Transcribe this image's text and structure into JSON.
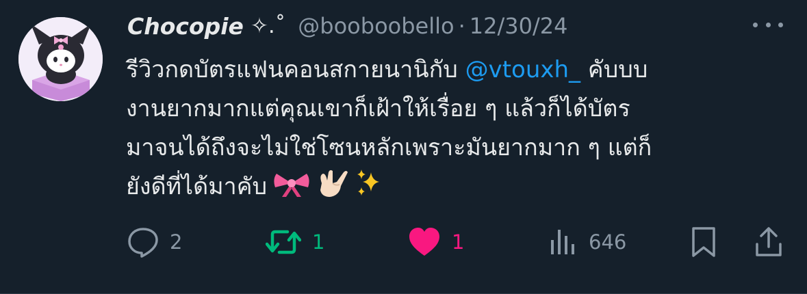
{
  "tweet": {
    "display_name": "Chocopie",
    "name_decoration": "✧.˚",
    "handle": "@booboobello",
    "separator": "·",
    "date": "12/30/24",
    "text_lines": [
      {
        "before": "รีวิวกดบัตรแฟนคอนสกายนานิกับ ",
        "mention": "@vtouxh_",
        "after": " คับบบ"
      },
      {
        "text": "งานยากมากแต่คุณเขาก็เฝ้าให้เรื่อย ๆ แล้วก็ได้บัตร"
      },
      {
        "text": "มาจนได้ถึงจะไม่ใช่โซนหลักเพราะมันยากมาก ๆ แต่ก็"
      },
      {
        "text": "ยังดีที่ได้มาคับ"
      }
    ],
    "emojis": [
      "ribbon-emoji",
      "rock-hand-emoji",
      "sparkles-emoji"
    ]
  },
  "actions": {
    "reply_count": "2",
    "retweet_count": "1",
    "like_count": "1",
    "views_count": "646"
  },
  "colors": {
    "background": "#15202b",
    "text": "#e7e9ea",
    "muted": "#8b98a5",
    "mention": "#1d9bf0",
    "retweet_active": "#00ba7c",
    "like_active": "#f91880"
  }
}
